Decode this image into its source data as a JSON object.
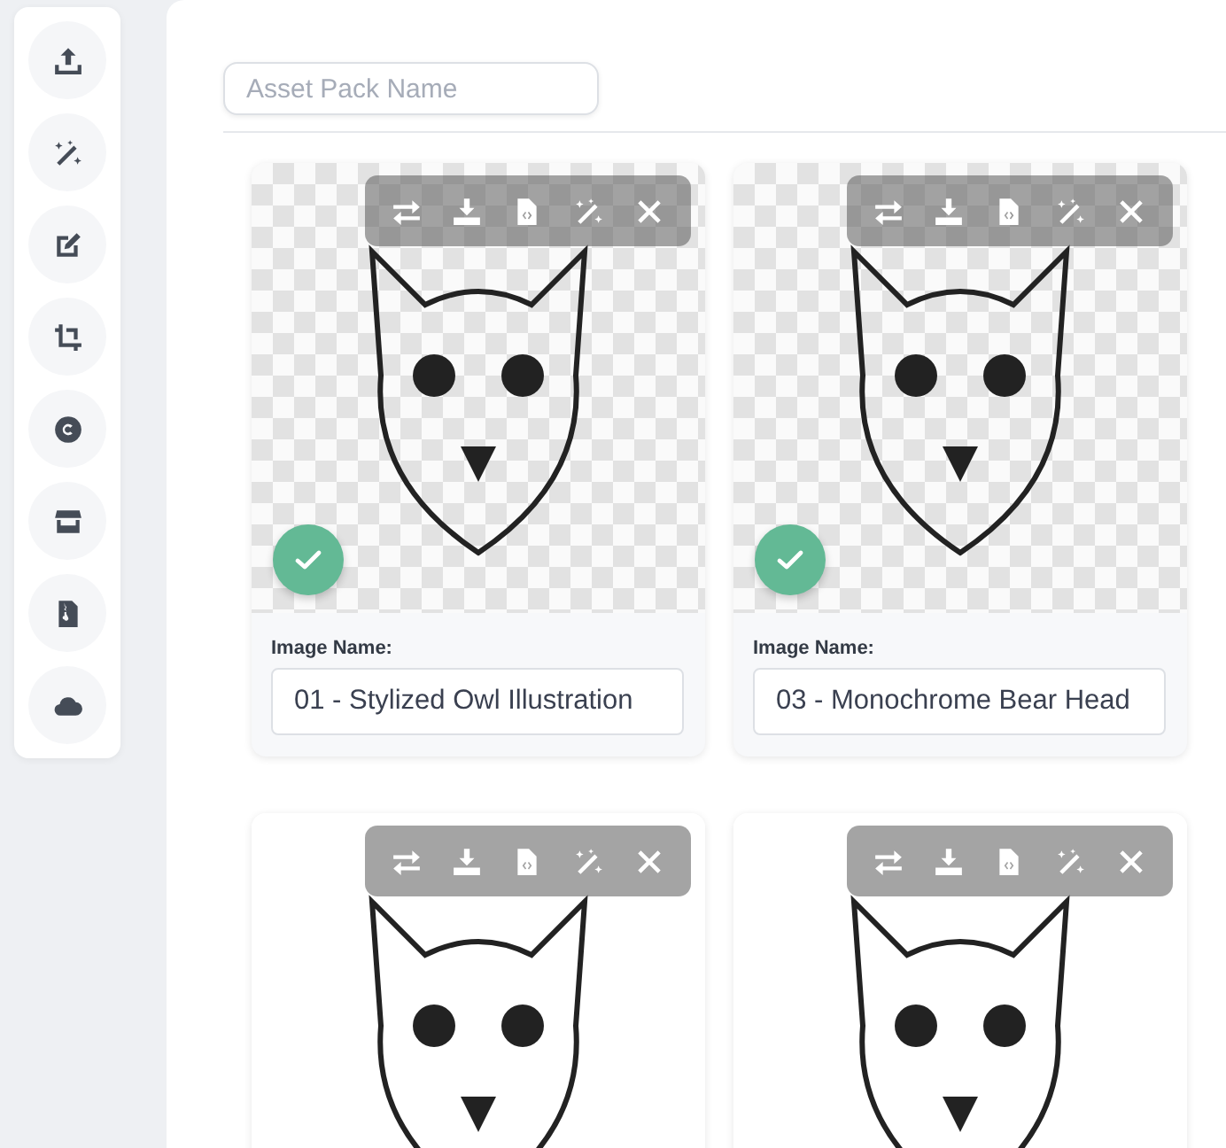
{
  "sidebar": {
    "buttons": [
      {
        "kind": "upload"
      },
      {
        "kind": "magic"
      },
      {
        "kind": "edit"
      },
      {
        "kind": "crop"
      },
      {
        "kind": "copyright"
      },
      {
        "kind": "store"
      },
      {
        "kind": "zip"
      },
      {
        "kind": "cloud"
      }
    ]
  },
  "asset_pack": {
    "placeholder": "Asset Pack Name"
  },
  "card_actions": [
    {
      "kind": "swap"
    },
    {
      "kind": "download"
    },
    {
      "kind": "file-code"
    },
    {
      "kind": "magic"
    },
    {
      "kind": "close"
    }
  ],
  "cards": [
    {
      "kind": "transparent",
      "selected": true,
      "name_label": "Image Name:",
      "name": "01 - Stylized Owl Illustration"
    },
    {
      "kind": "transparent",
      "selected": true,
      "name_label": "Image Name:",
      "name": "03 - Monochrome Bear Head"
    },
    {
      "kind": "plain"
    },
    {
      "kind": "plain"
    }
  ]
}
